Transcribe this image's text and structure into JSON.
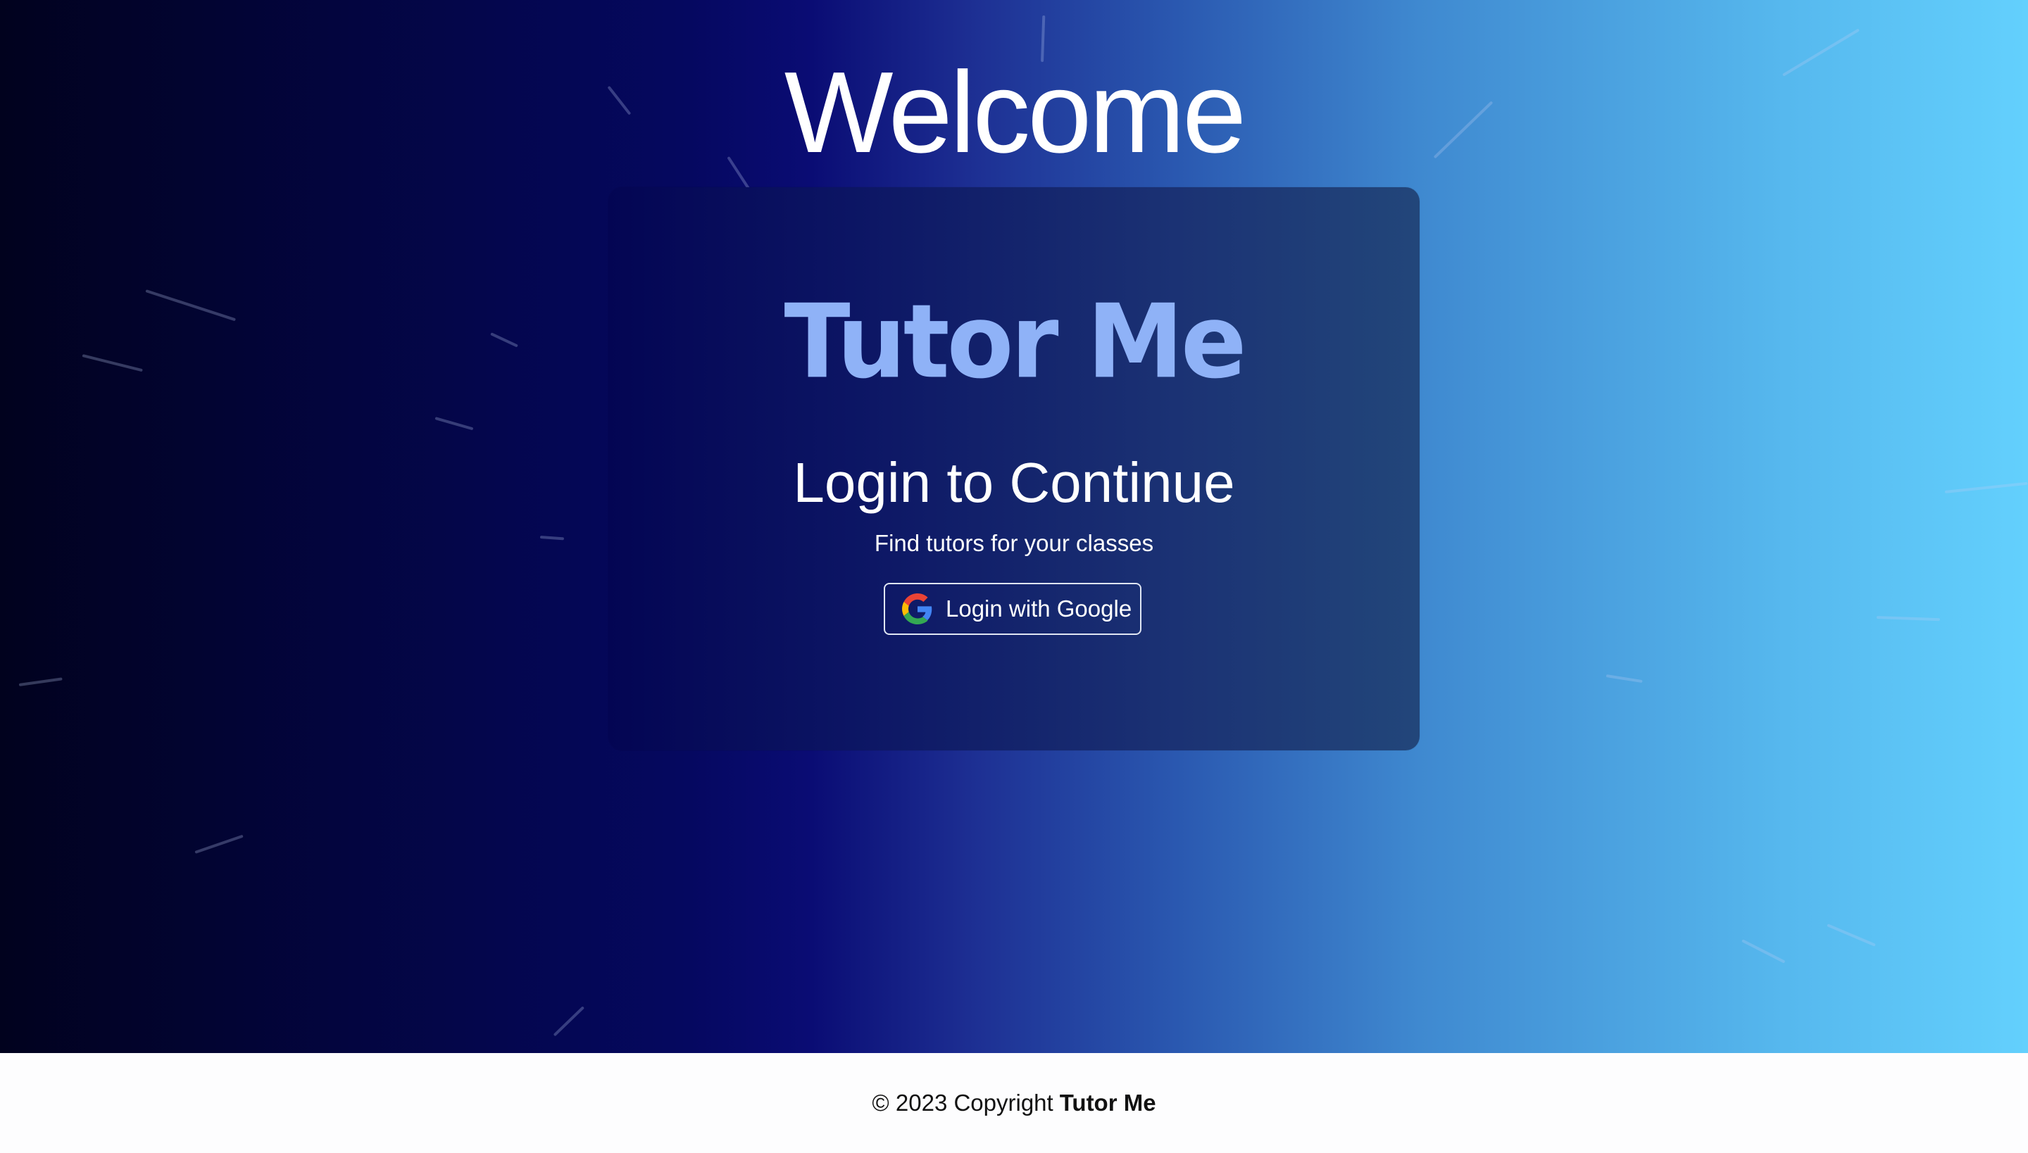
{
  "hero": {
    "welcome_text": "Welcome"
  },
  "card": {
    "brand_name": "Tutor Me",
    "title": "Login to Continue",
    "subtitle": "Find tutors for your classes",
    "google_button_label": "Login with Google",
    "google_icon": "google-g-icon"
  },
  "footer": {
    "copyright_prefix": "© 2023 Copyright",
    "company": "Tutor Me"
  },
  "colors": {
    "gradient_start": "#01021e",
    "gradient_mid": "#0a0c74",
    "gradient_end": "#63d0fd",
    "brand_text": "#8fb2f7",
    "card_left": "#030553",
    "card_right": "#22467a"
  }
}
